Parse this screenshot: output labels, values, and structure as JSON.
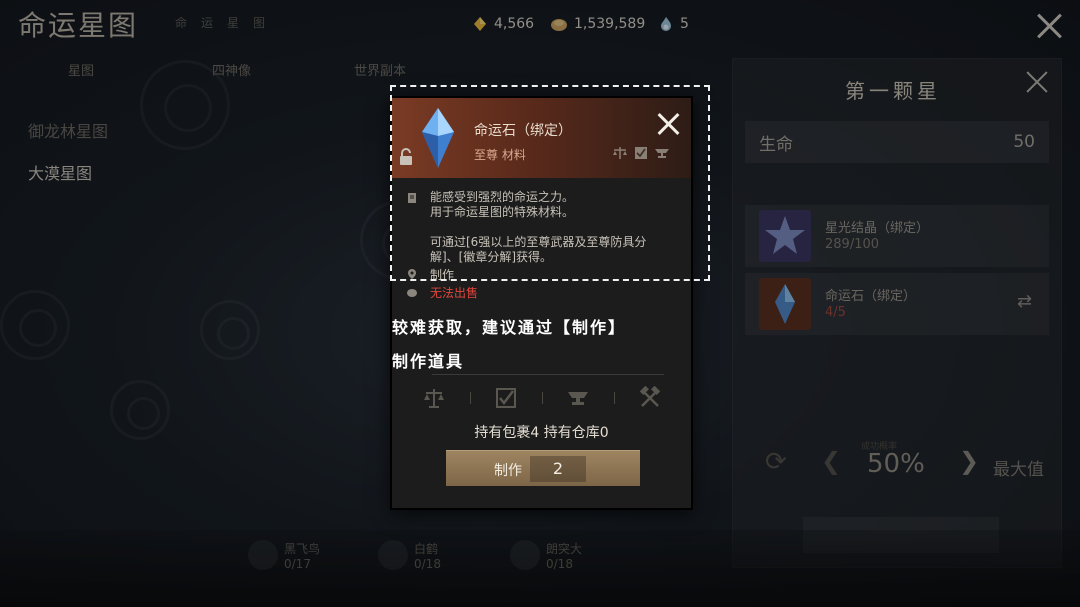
{
  "header": {
    "title": "命运星图",
    "subtitle": "命运星图",
    "currencies": [
      {
        "icon": "gold-diamond-icon",
        "value": "4,566"
      },
      {
        "icon": "coin-pouch-icon",
        "value": "1,539,589"
      },
      {
        "icon": "flame-orb-icon",
        "value": "5"
      }
    ]
  },
  "tabs": [
    "星图",
    "四神像",
    "世界副本"
  ],
  "left_list": [
    "御龙林星图",
    "大漠星图"
  ],
  "right_panel": {
    "title": "第一颗星",
    "stat": {
      "label": "生命",
      "value": "50"
    },
    "materials": [
      {
        "name": "星光结晶（绑定）",
        "count": "289/100",
        "icon": "star-crystal-icon"
      },
      {
        "name": "命运石（绑定）",
        "count": "4/5",
        "icon": "fate-stone-icon"
      }
    ],
    "percent": "50%",
    "max_label": "最大值",
    "rate_label": "成功概率"
  },
  "bottom_items": [
    {
      "name": "黑飞鸟",
      "count": "0/17"
    },
    {
      "name": "白鹤",
      "count": "0/18"
    },
    {
      "name": "朗突大",
      "count": "0/18"
    }
  ],
  "popup": {
    "item_name": "命运石（绑定）",
    "item_type": "至尊 材料",
    "desc_line1": "能感受到强烈的命运之力。",
    "desc_line2": "用于命运星图的特殊材料。",
    "desc_source": "可通过[6强以上的至尊武器及至尊防具分解]、[徽章分解]获得。",
    "source_label": "制作",
    "unsellable": "无法出售",
    "hold_text": "持有包裹4  持有仓库0",
    "craft_label": "制作",
    "craft_qty": "2"
  },
  "tip": {
    "line1": "较难获取，建议通过【制作】",
    "line2": "制作道具"
  },
  "colors": {
    "accent_red": "#e0463c",
    "header_rust": "#7a3b24",
    "button_tan": "#9e8461"
  }
}
